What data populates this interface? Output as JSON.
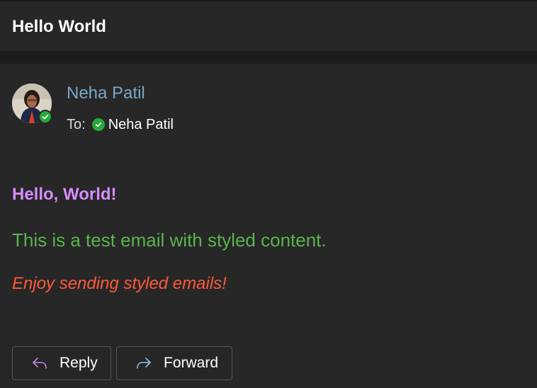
{
  "header": {
    "subject": "Hello World"
  },
  "message": {
    "sender_name": "Neha Patil",
    "to_label": "To:",
    "to_name": "Neha Patil",
    "greeting": "Hello, World!",
    "body": "This is a test email with styled content.",
    "closing": "Enjoy sending styled emails!"
  },
  "actions": {
    "reply_label": "Reply",
    "forward_label": "Forward"
  },
  "icons": {
    "reply": "reply-arrow-icon",
    "forward": "forward-arrow-icon",
    "presence": "available-check-icon"
  },
  "colors": {
    "background": "#272727",
    "sender": "#7aa8c8",
    "greeting": "#d78cff",
    "body": "#5ab44e",
    "closing": "#ff5a3a",
    "presence": "#27a93a"
  }
}
